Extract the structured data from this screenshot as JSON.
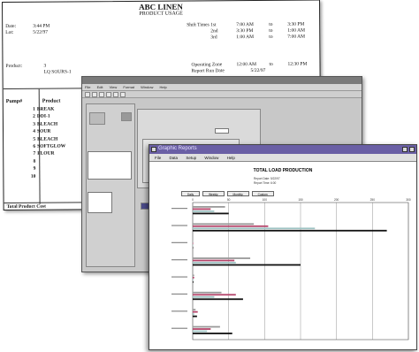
{
  "report": {
    "title": "ABC LINEN",
    "subtitle": "PRODUCT USAGE",
    "date_label": "Date:",
    "date_value": "3:44 PM",
    "lot_label": "Lot:",
    "lot_value": "5/22/97",
    "shift_label": "Shift Times 1st",
    "shift_2nd": "2nd",
    "shift_3rd": "3rd",
    "shift_rows": [
      [
        "7:00 AM",
        "to",
        "3:30 PM"
      ],
      [
        "3:30 PM",
        "to",
        "1:00 AM"
      ],
      [
        "1:00 AM",
        "to",
        "7:00 AM"
      ]
    ],
    "product_label": "Product:",
    "product_value": "3",
    "product_name": "LQ SOURS-1",
    "operating_label": "Operating Zone",
    "operating_values": [
      "12:00 AM",
      "to",
      "12:30 PM"
    ],
    "report_label": "Report Run Date",
    "report_value": "5/22/97",
    "col_pump": "Pump#",
    "col_product": "Product",
    "rows": [
      {
        "num": "1",
        "name": "BREAK"
      },
      {
        "num": "2",
        "name": "DDI-1"
      },
      {
        "num": "3",
        "name": "BLEACH"
      },
      {
        "num": "4",
        "name": "SOUR"
      },
      {
        "num": "5",
        "name": "BLEACH"
      },
      {
        "num": "6",
        "name": "SOFTGLOW"
      },
      {
        "num": "7",
        "name": "FLOUR"
      },
      {
        "num": "8",
        "name": ""
      },
      {
        "num": "9",
        "name": ""
      },
      {
        "num": "10",
        "name": ""
      }
    ],
    "footer": "Total Product Cost"
  },
  "mid_window": {
    "menu": [
      "File",
      "Edit",
      "View",
      "Format",
      "Window",
      "Help"
    ]
  },
  "front_window": {
    "title": "Graphic Reports",
    "menu": [
      "File",
      "Data",
      "Setup",
      "Window",
      "Help"
    ],
    "chart_title": "TOTAL LOAD PRODUCTION",
    "sub_lines": [
      "Report Date:  5/22/97",
      "Report Time:  6:00"
    ],
    "tabs": [
      "Daily",
      "Weekly",
      "Monthly",
      "Custom"
    ]
  },
  "chart_data": {
    "type": "bar",
    "orientation": "horizontal",
    "title": "TOTAL LOAD PRODUCTION",
    "xlim": [
      0,
      300
    ],
    "xticks": [
      0,
      50,
      100,
      150,
      200,
      250,
      300
    ],
    "categories": [
      "C1",
      "C2",
      "C3",
      "C4",
      "C5",
      "C6",
      "C7",
      "C8"
    ],
    "series": [
      {
        "color": "#9a9a9a",
        "values": [
          45,
          85,
          0,
          80,
          2,
          40,
          4,
          38
        ]
      },
      {
        "color": "#b4446a",
        "values": [
          25,
          105,
          0,
          58,
          2,
          60,
          7,
          25
        ]
      },
      {
        "color": "#9fc4c4",
        "values": [
          30,
          170,
          0,
          60,
          1,
          30,
          2,
          20
        ]
      },
      {
        "color": "#111111",
        "values": [
          50,
          270,
          0,
          150,
          1,
          70,
          6,
          55
        ]
      }
    ],
    "grid": true
  }
}
